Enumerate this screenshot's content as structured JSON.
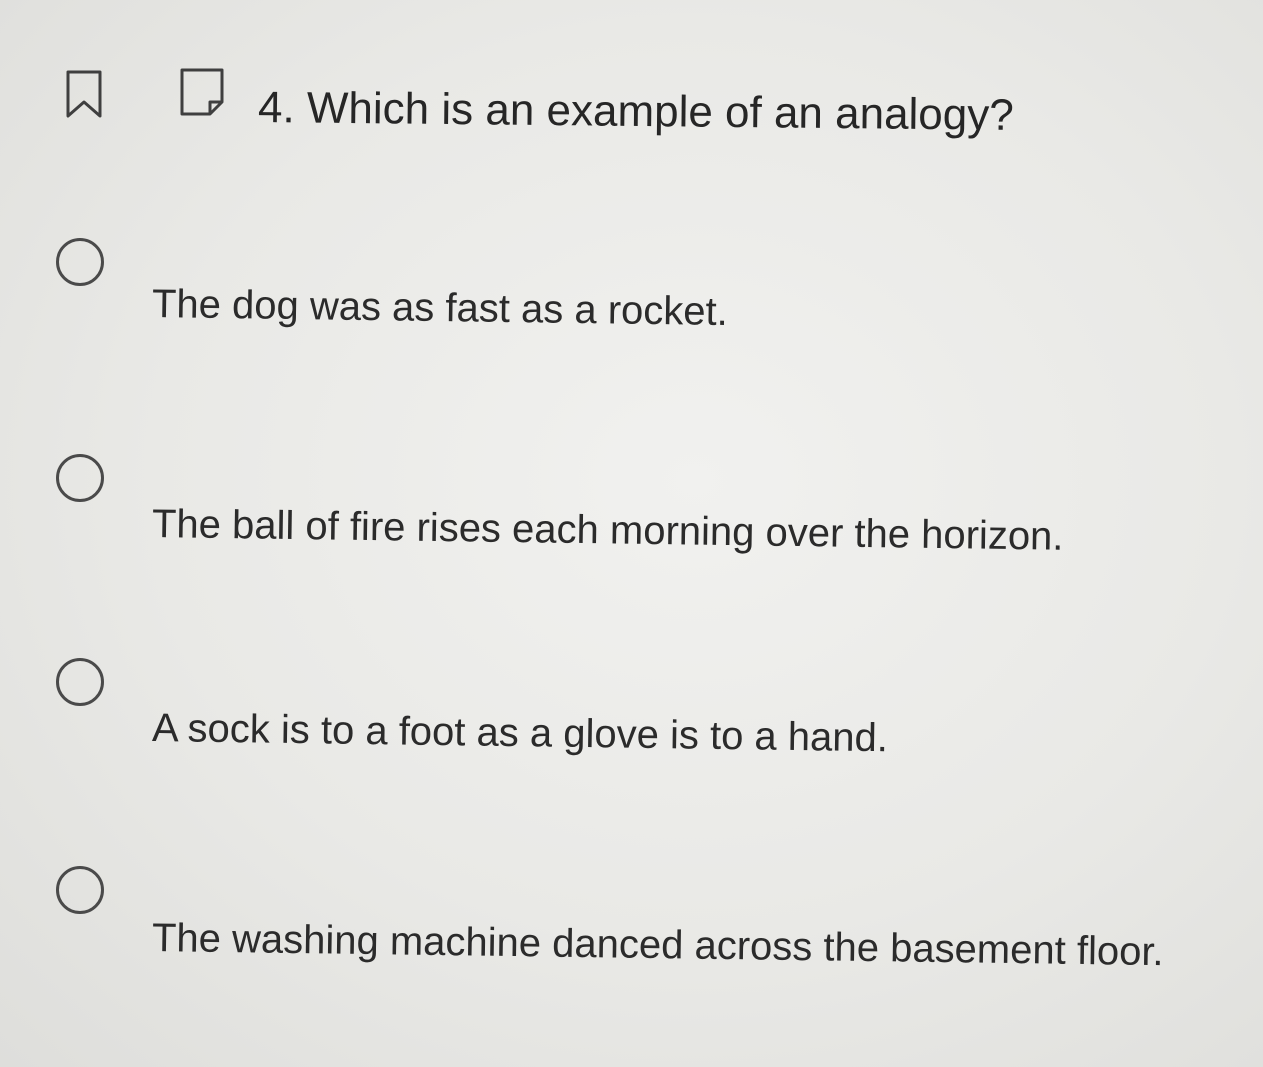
{
  "question": {
    "text": "4. Which is an example of an analogy?"
  },
  "options": [
    {
      "label": "The dog was as fast as a rocket."
    },
    {
      "label": "The ball of fire rises each morning over the horizon."
    },
    {
      "label": "A sock is to a foot as a glove is to a hand."
    },
    {
      "label": "The washing machine danced across the basement floor."
    }
  ],
  "icons": {
    "bookmark": "bookmark-icon",
    "flag": "flag-icon"
  },
  "colors": {
    "text": "#2e2e2e",
    "radio_border": "#4a4a4a",
    "background": "#ececea"
  }
}
